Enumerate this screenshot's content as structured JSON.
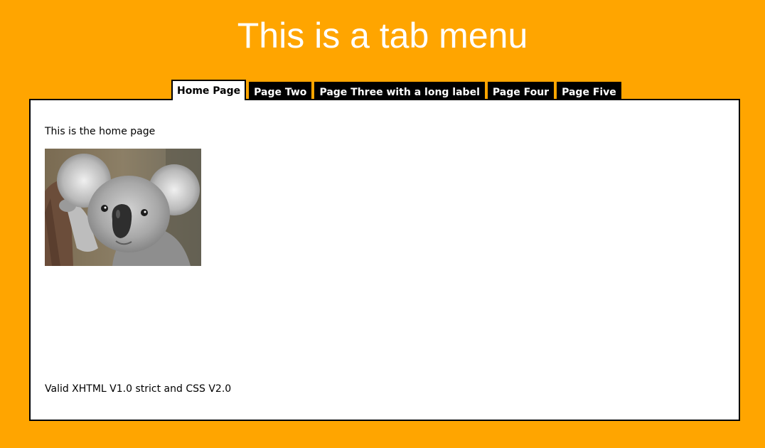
{
  "header": {
    "title": "This is a tab menu"
  },
  "tabs": [
    {
      "label": "Home Page",
      "active": true
    },
    {
      "label": "Page Two",
      "active": false
    },
    {
      "label": "Page Three with a long label",
      "active": false
    },
    {
      "label": "Page Four",
      "active": false
    },
    {
      "label": "Page Five",
      "active": false
    }
  ],
  "content": {
    "intro": "This is the home page",
    "image_subject": "koala",
    "footer": "Valid XHTML V1.0 strict and CSS V2.0"
  },
  "colors": {
    "background": "#FFA500",
    "tab_inactive": "#000000",
    "tab_active": "#FFFFFF",
    "panel": "#FFFFFF"
  }
}
